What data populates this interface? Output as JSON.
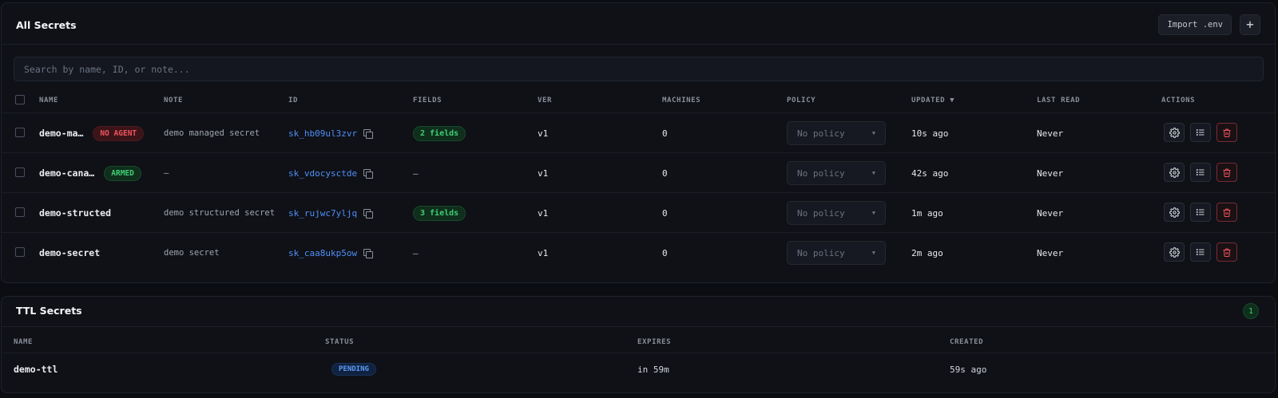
{
  "all_secrets": {
    "title": "All Secrets",
    "import_label": "Import .env",
    "add_label": "+",
    "search_placeholder": "Search by name, ID, or note...",
    "columns": {
      "name": "NAME",
      "note": "NOTE",
      "id": "ID",
      "fields": "FIELDS",
      "ver": "VER",
      "machines": "MACHINES",
      "policy": "POLICY",
      "updated": "UPDATED ▼",
      "last_read": "LAST READ",
      "actions": "ACTIONS"
    },
    "rows": [
      {
        "name": "demo-ma…",
        "badge": "NO AGENT",
        "badge_color": "#f0545f",
        "note": "demo managed secret",
        "id": "sk_hb09ul3zvr",
        "fields": "2 fields",
        "ver": "v1",
        "machines": "0",
        "policy": "No policy",
        "updated": "10s ago",
        "last_read": "Never"
      },
      {
        "name": "demo-cana…",
        "badge": "ARMED",
        "badge_color": "#3fcf75",
        "note": "—",
        "id": "sk_vdocysctde",
        "fields": "—",
        "ver": "v1",
        "machines": "0",
        "policy": "No policy",
        "updated": "42s ago",
        "last_read": "Never"
      },
      {
        "name": "demo-structed",
        "badge": "",
        "note": "demo structured secret",
        "id": "sk_rujwc7yljq",
        "fields": "3 fields",
        "ver": "v1",
        "machines": "0",
        "policy": "No policy",
        "updated": "1m ago",
        "last_read": "Never"
      },
      {
        "name": "demo-secret",
        "badge": "",
        "note": "demo secret",
        "id": "sk_caa8ukp5ow",
        "fields": "—",
        "ver": "v1",
        "machines": "0",
        "policy": "No policy",
        "updated": "2m ago",
        "last_read": "Never"
      }
    ],
    "icons": {
      "settings": "gear-icon",
      "history": "list-icon",
      "delete": "trash-icon"
    }
  },
  "ttl_secrets": {
    "title": "TTL Secrets",
    "count": "1",
    "columns": {
      "name": "NAME",
      "status": "STATUS",
      "expires": "EXPIRES",
      "created": "CREATED"
    },
    "rows": [
      {
        "name": "demo-ttl",
        "status": "PENDING",
        "expires": "in 59m",
        "created": "59s ago"
      }
    ]
  },
  "colors": {
    "background": "#0b0d12",
    "panel": "#0f1117",
    "link": "#4f8ff7",
    "success": "#3fcf75",
    "danger": "#f0545f"
  }
}
